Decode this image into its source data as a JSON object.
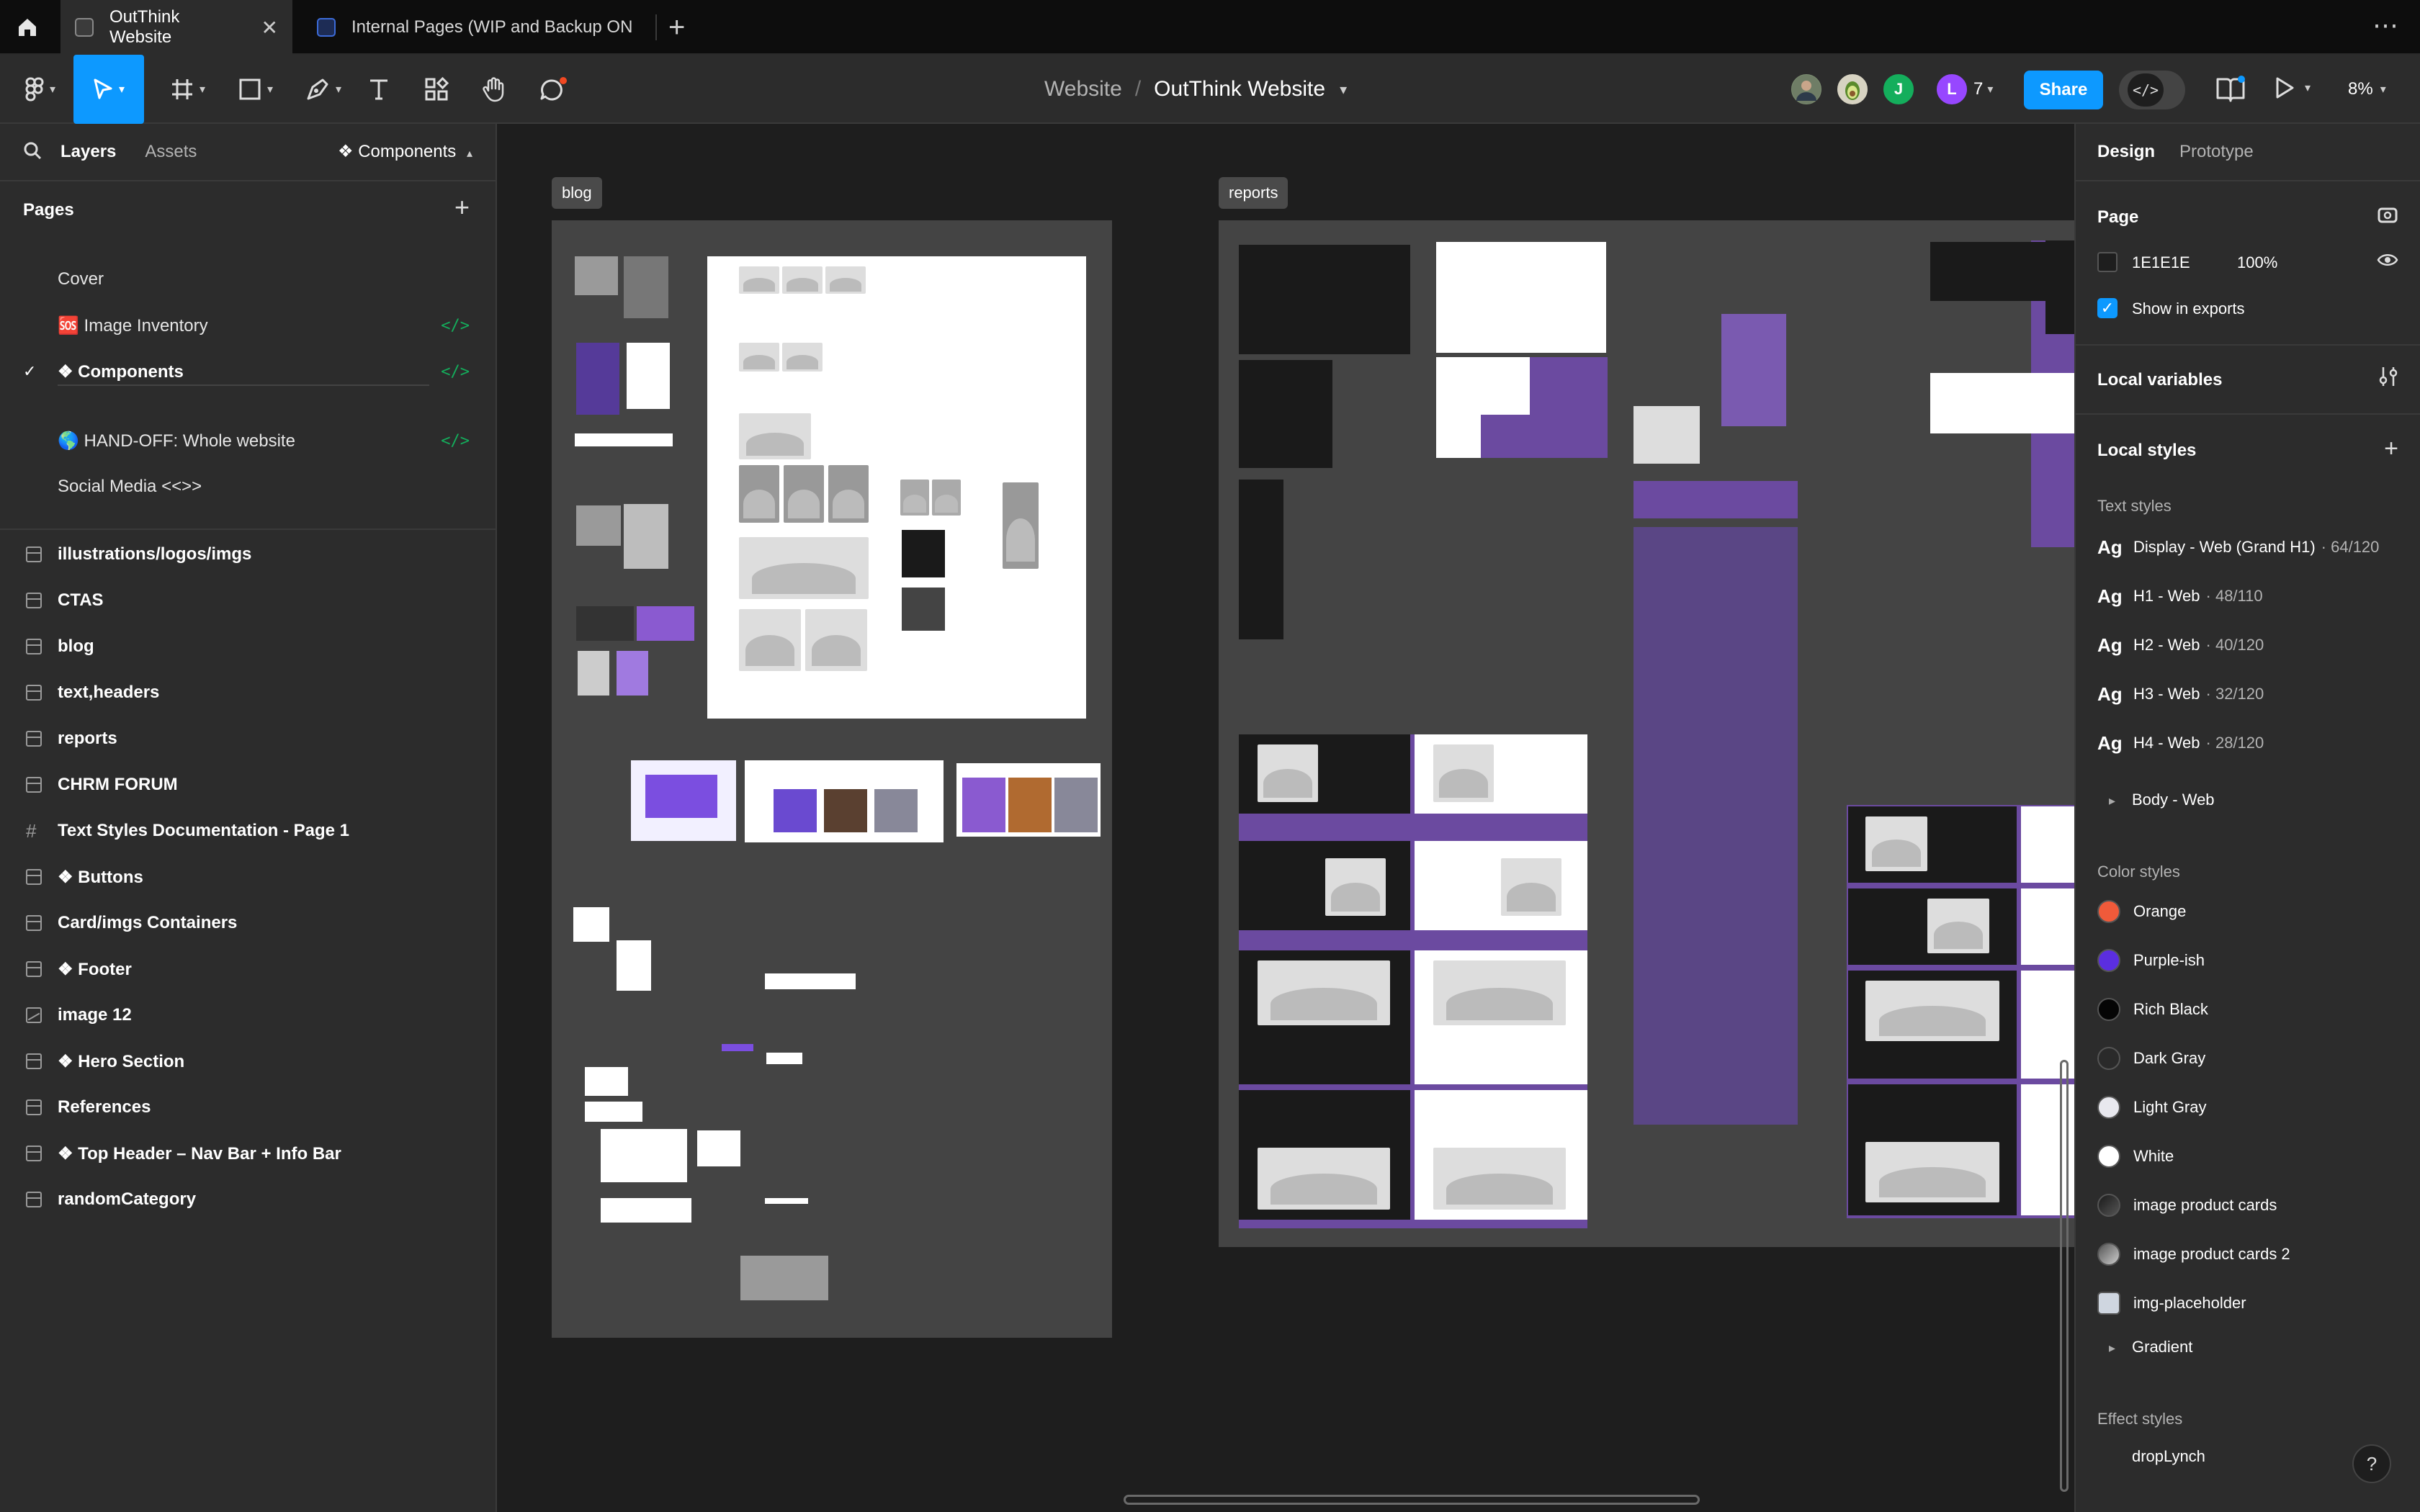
{
  "browser": {
    "tabs": [
      {
        "title": "OutThink Website",
        "active": true
      },
      {
        "title": "Internal Pages (WIP and Backup ONL",
        "active": false
      }
    ],
    "close_glyph": "✕",
    "add_glyph": "+",
    "more_glyph": "⋯"
  },
  "toolbar": {
    "breadcrumb_parent": "Website",
    "breadcrumb_sep": "/",
    "file_name": "OutThink Website",
    "share_label": "Share",
    "devmode_glyph": "</>",
    "collaborators": [
      {
        "initial": "",
        "color": "#7a8b6f",
        "kind": "photo"
      },
      {
        "initial": "",
        "color": "#d7d3c2",
        "kind": "emoji"
      },
      {
        "initial": "J",
        "color": "#14ae5c"
      },
      {
        "initial": "L",
        "color": "#9747ff"
      }
    ],
    "collaborator_count": "7",
    "zoom": "8%",
    "accent": "#0d99ff"
  },
  "left_panel": {
    "tabs": {
      "layers": "Layers",
      "assets": "Assets"
    },
    "page_dropdown": "❖ Components",
    "pages_heading": "Pages",
    "pages": [
      {
        "label": "Cover",
        "current": false,
        "dev": false
      },
      {
        "label": "🆘 Image Inventory",
        "current": false,
        "dev": true
      },
      {
        "label": "❖ Components",
        "current": true,
        "dev": true
      },
      {
        "label": "🌎 HAND-OFF: Whole website",
        "current": false,
        "dev": true
      },
      {
        "label": "Social Media <<>>",
        "current": false,
        "dev": false
      }
    ],
    "dev_glyph": "</>",
    "check_glyph": "✓",
    "layers": [
      {
        "label": "illustrations/logos/imgs",
        "icon": "section-icon"
      },
      {
        "label": "CTAS",
        "icon": "section-icon"
      },
      {
        "label": "blog",
        "icon": "section-icon"
      },
      {
        "label": "text,headers",
        "icon": "section-icon"
      },
      {
        "label": "reports",
        "icon": "section-icon"
      },
      {
        "label": "CHRM FORUM",
        "icon": "section-icon"
      },
      {
        "label": "Text Styles Documentation - Page 1",
        "icon": "frame-icon"
      },
      {
        "label": "❖ Buttons",
        "icon": "section-icon"
      },
      {
        "label": "Card/imgs Containers",
        "icon": "section-icon"
      },
      {
        "label": "❖ Footer",
        "icon": "section-icon"
      },
      {
        "label": "image 12",
        "icon": "image-icon"
      },
      {
        "label": "❖ Hero Section",
        "icon": "section-icon"
      },
      {
        "label": "References",
        "icon": "section-icon"
      },
      {
        "label": "❖ Top Header – Nav Bar + Info Bar",
        "icon": "section-icon"
      },
      {
        "label": "randomCategory",
        "icon": "section-icon"
      }
    ]
  },
  "canvas": {
    "sections": [
      {
        "label": "blog"
      },
      {
        "label": "reports"
      }
    ]
  },
  "right_panel": {
    "tabs": {
      "design": "Design",
      "prototype": "Prototype"
    },
    "page_heading": "Page",
    "page_color_hex": "1E1E1E",
    "page_color": "#1e1e1e",
    "page_opacity": "100%",
    "show_in_exports": "Show in exports",
    "local_variables": "Local variables",
    "local_styles": "Local styles",
    "text_styles_heading": "Text styles",
    "text_styles": [
      {
        "name": "Display - Web (Grand H1)",
        "meta": "· 64/120"
      },
      {
        "name": "H1 - Web",
        "meta": "· 48/110"
      },
      {
        "name": "H2 - Web",
        "meta": "· 40/120"
      },
      {
        "name": "H3 - Web",
        "meta": "· 32/120"
      },
      {
        "name": "H4 - Web",
        "meta": "· 28/120"
      }
    ],
    "ag_glyph": "Ag",
    "body_group": "Body - Web",
    "color_styles_heading": "Color styles",
    "color_styles": [
      {
        "name": "Orange",
        "color": "#f05a3a"
      },
      {
        "name": "Purple-ish",
        "color": "#5b2ee0"
      },
      {
        "name": "Rich Black",
        "color": "#050505"
      },
      {
        "name": "Dark Gray",
        "color": "#2a2a2a"
      },
      {
        "name": "Light Gray",
        "color": "#e8e8ee"
      },
      {
        "name": "White",
        "color": "#ffffff"
      },
      {
        "name": "image product cards",
        "color": "#3a3a3a"
      },
      {
        "name": "image product cards 2",
        "color": "#8a8a8a"
      },
      {
        "name": "img-placeholder",
        "color": "#cfd6e0"
      }
    ],
    "gradient_group": "Gradient",
    "effect_styles_heading": "Effect styles",
    "effect_styles": [
      {
        "name": "dropLynch"
      }
    ],
    "help_glyph": "?"
  }
}
